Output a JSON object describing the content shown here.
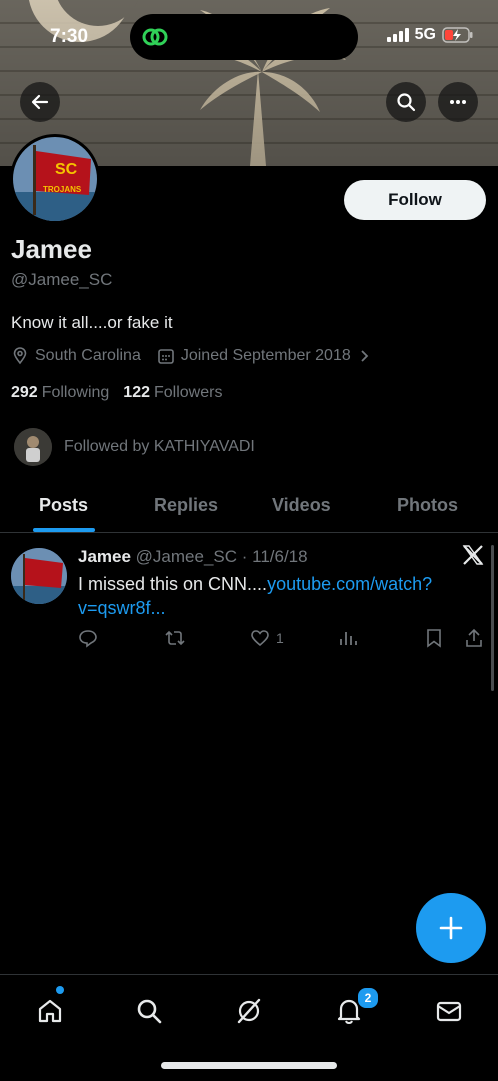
{
  "status_bar": {
    "time": "7:30",
    "network": "5G"
  },
  "profile": {
    "name": "Jamee",
    "handle": "@Jamee_SC",
    "bio": "Know it all....or fake it",
    "location": "South Carolina",
    "joined": "Joined September 2018",
    "following_count": "292",
    "following_label": "Following",
    "followers_count": "122",
    "followers_label": "Followers",
    "followed_by": "Followed by KATHIYAVADI",
    "avatar_flag_text": "TROJANS",
    "avatar_flag_letters": "SC"
  },
  "follow_button": "Follow",
  "tabs": [
    {
      "label": "Posts",
      "active": true
    },
    {
      "label": "Replies",
      "active": false
    },
    {
      "label": "Videos",
      "active": false
    },
    {
      "label": "Photos",
      "active": false
    }
  ],
  "tweet": {
    "name": "Jamee",
    "handle_date": "@Jamee_SC · 11/6/18",
    "text": "I missed this on CNN....",
    "link": "youtube.com/watch?v=qswr8f...",
    "likes": "1"
  },
  "nav": {
    "notifications_badge": "2"
  },
  "colors": {
    "accent": "#1d9bf0",
    "background": "#000000",
    "muted": "#71767b",
    "text": "#e7e9ea"
  },
  "icons": [
    "back-arrow-icon",
    "search-icon",
    "more-icon",
    "location-pin-icon",
    "calendar-icon",
    "chevron-right-icon",
    "x-logo-icon",
    "reply-icon",
    "retweet-icon",
    "like-icon",
    "views-icon",
    "bookmark-icon",
    "share-icon",
    "plus-icon",
    "home-icon",
    "explore-icon",
    "grok-icon",
    "bell-icon",
    "mail-icon"
  ]
}
